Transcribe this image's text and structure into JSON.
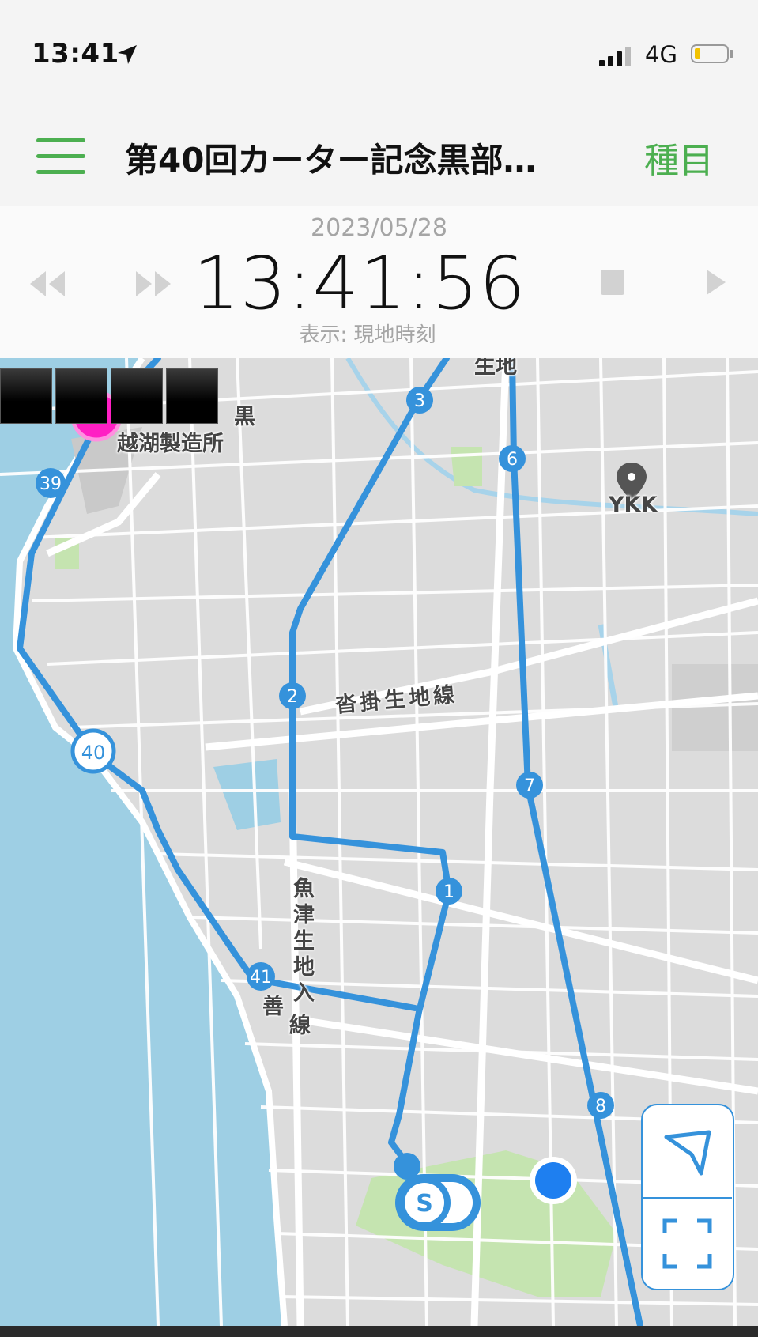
{
  "status_bar": {
    "time": "13:41",
    "network": "4G"
  },
  "nav": {
    "title": "第40回カーター記念黒部…",
    "action": "種目"
  },
  "time_panel": {
    "date": "2023/05/28",
    "time": "13:41:56",
    "display_mode": "表示: 現地時刻"
  },
  "map": {
    "labels": {
      "factory_line1": "黒",
      "factory_line2": "越湖製造所",
      "ykk": "YKK",
      "road_east_west": "沓掛生地線",
      "road_vertical_1": "魚津生地入",
      "road_vertical_2": "善",
      "road_vertical_3": "線",
      "top_cut": "生地"
    },
    "course_markers": [
      "1",
      "2",
      "3",
      "6",
      "7",
      "8",
      "39",
      "40",
      "41"
    ],
    "start_marker": "S"
  },
  "colors": {
    "accent_green": "#4caf50",
    "route_blue": "#3592db",
    "current_location": "#1e7ff0",
    "runner_pin": "#ff1fc4",
    "sea": "#9ecfe4",
    "park": "#c5e4b0"
  }
}
